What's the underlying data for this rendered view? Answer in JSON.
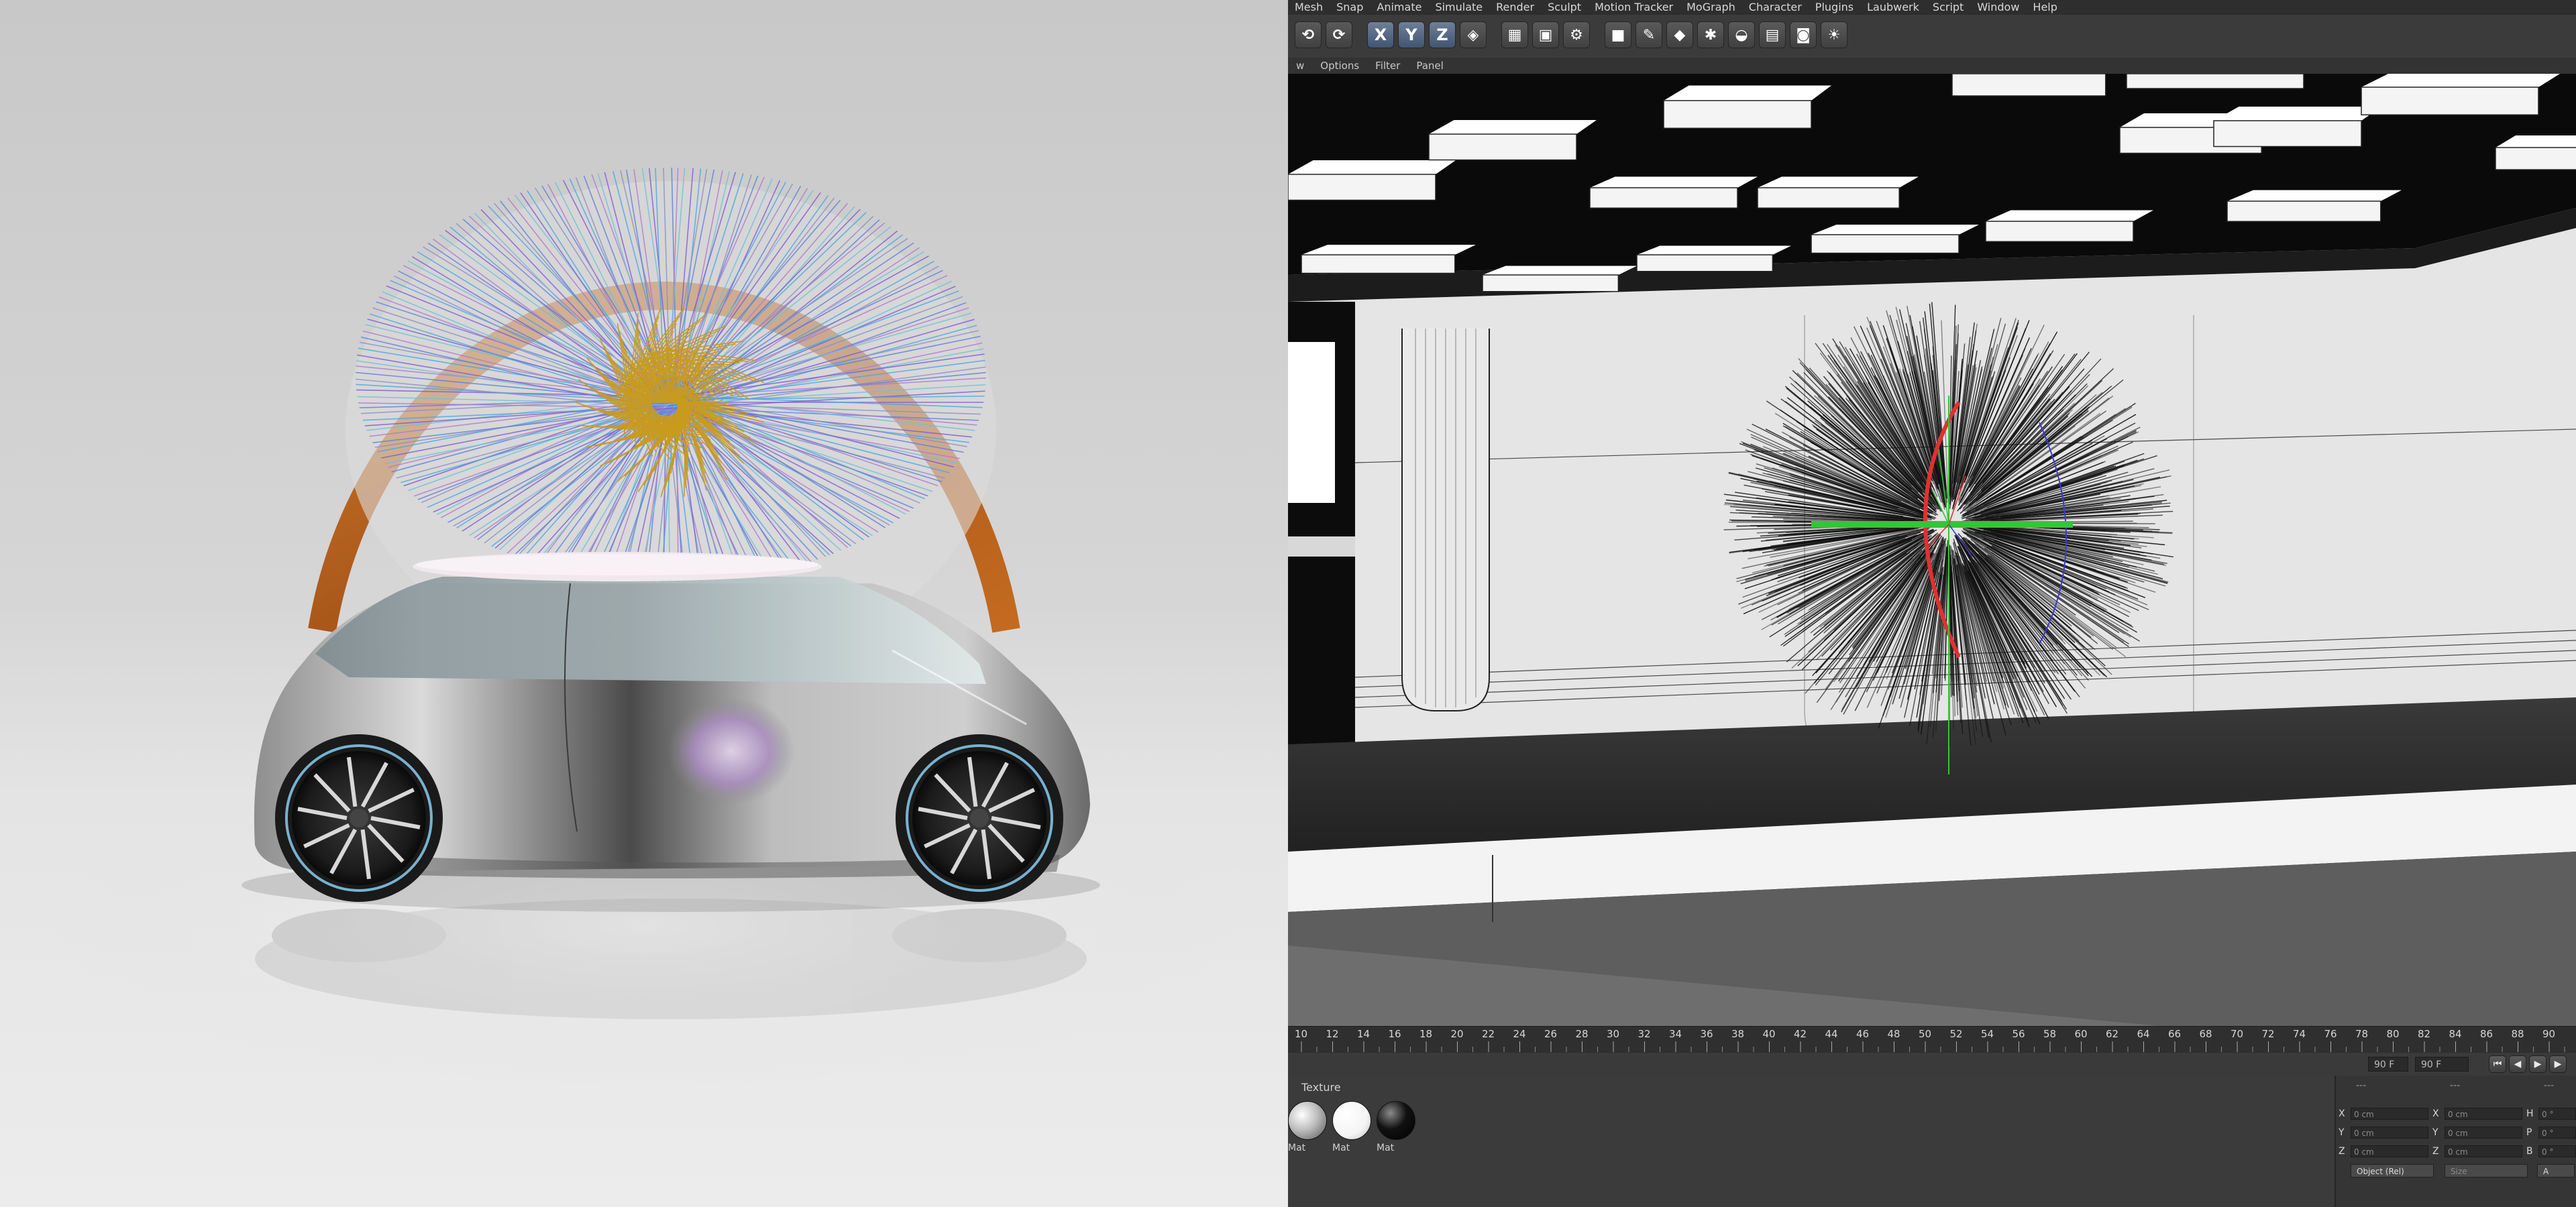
{
  "menu": [
    "Mesh",
    "Snap",
    "Animate",
    "Simulate",
    "Render",
    "Sculpt",
    "Motion Tracker",
    "MoGraph",
    "Character",
    "Plugins",
    "Laubwerk",
    "Script",
    "Window",
    "Help"
  ],
  "toolbar": {
    "axes": [
      "X",
      "Y",
      "Z"
    ],
    "icons": [
      "undo-icon",
      "redo-icon",
      "lock-x-icon",
      "lock-y-icon",
      "lock-z-icon",
      "world-coords-icon",
      "render-view-icon",
      "render-picture-viewer-icon",
      "edit-render-settings-icon",
      "cube-icon",
      "pen-spline-icon",
      "subdivision-icon",
      "array-icon",
      "deformer-icon",
      "floor-icon",
      "camera-icon",
      "light-icon"
    ]
  },
  "viewport_menu": [
    "w",
    "Options",
    "Filter",
    "Panel"
  ],
  "timeline": {
    "ticks": [
      "10",
      "12",
      "14",
      "16",
      "18",
      "20",
      "22",
      "24",
      "26",
      "28",
      "30",
      "32",
      "34",
      "36",
      "38",
      "40",
      "42",
      "44",
      "46",
      "48",
      "50",
      "52",
      "54",
      "56",
      "58",
      "60",
      "62",
      "64",
      "66",
      "68",
      "70",
      "72",
      "74",
      "76",
      "78",
      "80",
      "82",
      "84",
      "86",
      "88",
      "90"
    ],
    "end_field": "90 F",
    "current_field": "90 F"
  },
  "materials": {
    "title": "Texture",
    "items": [
      {
        "label": "Mat",
        "color": "#d9d9d9"
      },
      {
        "label": "Mat",
        "color": "#ffffff"
      },
      {
        "label": "Mat",
        "color": "#111111"
      }
    ]
  },
  "coordinates": {
    "header": [
      "---",
      "---",
      "---"
    ],
    "rows": [
      {
        "a": "X",
        "pos": "0 cm",
        "b": "X",
        "size": "0 cm",
        "c": "H",
        "rot": "0 °"
      },
      {
        "a": "Y",
        "pos": "0 cm",
        "b": "Y",
        "size": "0 cm",
        "c": "P",
        "rot": "0 °"
      },
      {
        "a": "Z",
        "pos": "0 cm",
        "b": "Z",
        "size": "0 cm",
        "c": "B",
        "rot": "0 °"
      }
    ],
    "mode_dropdown": "Object (Rel)",
    "size_dropdown": "Size",
    "apply_label": "A"
  },
  "colors": {
    "wood": "#b4611c",
    "gold": "#c99b1f",
    "axis_x": "#e23030",
    "axis_y": "#35c43a",
    "axis_z": "#3b3bcf"
  }
}
